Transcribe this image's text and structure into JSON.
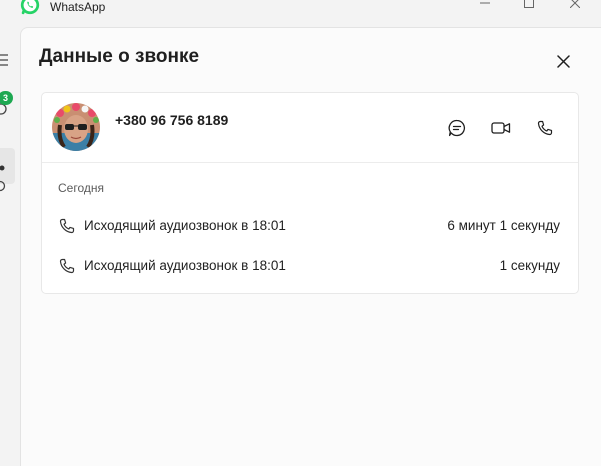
{
  "app": {
    "title": "WhatsApp"
  },
  "rail": {
    "badge_count": "3"
  },
  "panel": {
    "title": "Данные о звонке"
  },
  "contact": {
    "phone": "+380 96 756 8189"
  },
  "calls": {
    "day_label": "Сегодня",
    "items": [
      {
        "description": "Исходящий аудиозвонок в 18:01",
        "duration": "6 минут 1 секунду"
      },
      {
        "description": "Исходящий аудиозвонок в 18:01",
        "duration": "1 секунду"
      }
    ]
  },
  "icons": {
    "logo": "whatsapp-logo-icon",
    "close": "close-icon",
    "message": "chat-bubble-icon",
    "video": "video-camera-icon",
    "voice": "phone-icon"
  },
  "colors": {
    "brand": "#25d366",
    "badge": "#1da851",
    "panel_bg": "#fbfbfb"
  }
}
